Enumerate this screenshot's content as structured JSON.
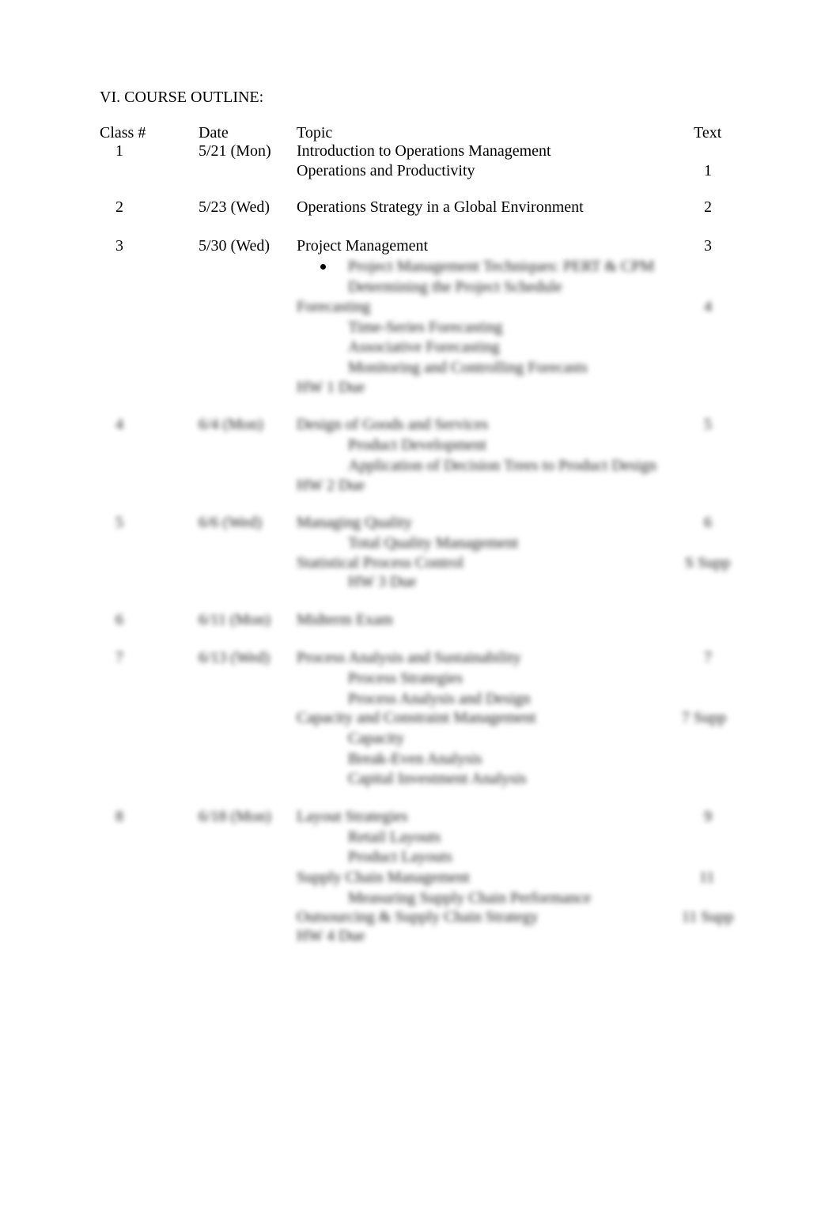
{
  "section_title": "VI.  COURSE OUTLINE:",
  "columns": {
    "class": "Class #",
    "date": "Date",
    "topic": "Topic",
    "text": "Text"
  },
  "rows": [
    {
      "class": "1",
      "date": "5/21 (Mon)",
      "topic_1": "Introduction to Operations Management",
      "topic_2": "Operations and Productivity",
      "text": "1"
    },
    {
      "class": "2",
      "date": "5/23 (Wed)",
      "topic_1": "Operations Strategy in a Global Environment",
      "text": "2"
    },
    {
      "class": "3",
      "date": "5/30 (Wed)",
      "topic_1": "Project Management",
      "text": "3",
      "items": [
        "Project Management Techniques: PERT & CPM",
        "Determining the Project Schedule",
        "Forecasting",
        "Time-Series Forecasting",
        "Associative Forecasting",
        "Monitoring and Controlling Forecasts",
        "HW 1 Due"
      ],
      "text_2": "4"
    },
    {
      "class": "4",
      "date": "6/4 (Mon)",
      "topic_1": "Design of Goods and Services",
      "text": "5",
      "items": [
        "Product Development",
        "Application of Decision Trees to Product Design",
        "HW 2 Due"
      ]
    },
    {
      "class": "5",
      "date": "6/6 (Wed)",
      "topic_1": "Managing Quality",
      "text": "6",
      "items": [
        "Total Quality Management",
        "Statistical Process Control",
        "HW 3 Due"
      ],
      "text_2": "S Supp"
    },
    {
      "class": "6",
      "date": "6/11 (Mon)",
      "topic_1": "Midterm Exam"
    },
    {
      "class": "7",
      "date": "6/13 (Wed)",
      "topic_1": "Process Analysis and Sustainability",
      "text": "7",
      "items": [
        "Process Strategies",
        "Process Analysis and Design",
        "Capacity and Constraint Management",
        "Capacity",
        "Break-Even Analysis",
        "Capital Investment Analysis"
      ],
      "text_2": "7 Supp"
    },
    {
      "class": "8",
      "date": "6/18 (Mon)",
      "topic_1": "Layout Strategies",
      "text": "9",
      "items": [
        "Retail Layouts",
        "Product Layouts",
        "Supply Chain Management",
        "Measuring Supply Chain Performance",
        "Outsourcing & Supply Chain Strategy",
        "HW 4 Due"
      ],
      "text_2": "11",
      "text_3": "11 Supp"
    }
  ]
}
